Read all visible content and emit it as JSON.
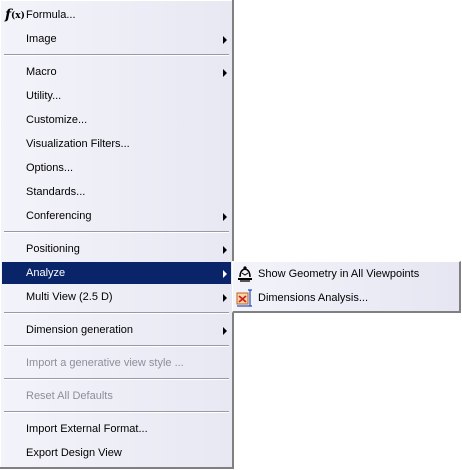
{
  "menu": {
    "items": [
      {
        "label": "Formula..."
      },
      {
        "label": "Image"
      },
      {
        "label": "Macro"
      },
      {
        "label": "Utility..."
      },
      {
        "label": "Customize..."
      },
      {
        "label": "Visualization Filters..."
      },
      {
        "label": "Options..."
      },
      {
        "label": "Standards..."
      },
      {
        "label": "Conferencing"
      },
      {
        "label": "Positioning"
      },
      {
        "label": "Analyze"
      },
      {
        "label": "Multi View (2.5 D)"
      },
      {
        "label": "Dimension generation"
      },
      {
        "label": "Import a generative view style ..."
      },
      {
        "label": "Reset All Defaults"
      },
      {
        "label": "Import External Format..."
      },
      {
        "label": "Export Design View"
      }
    ]
  },
  "submenu": {
    "items": [
      {
        "label": "Show Geometry in All Viewpoints"
      },
      {
        "label": "Dimensions Analysis..."
      }
    ]
  },
  "icons": {
    "formula": "formula-icon",
    "show_geometry": "show-geometry-icon",
    "dimensions_analysis": "dimensions-analysis-icon"
  },
  "colors": {
    "selected_bg": "#0a246a",
    "disabled_text": "#8e8e9a",
    "menu_bg": "#ececf5"
  }
}
